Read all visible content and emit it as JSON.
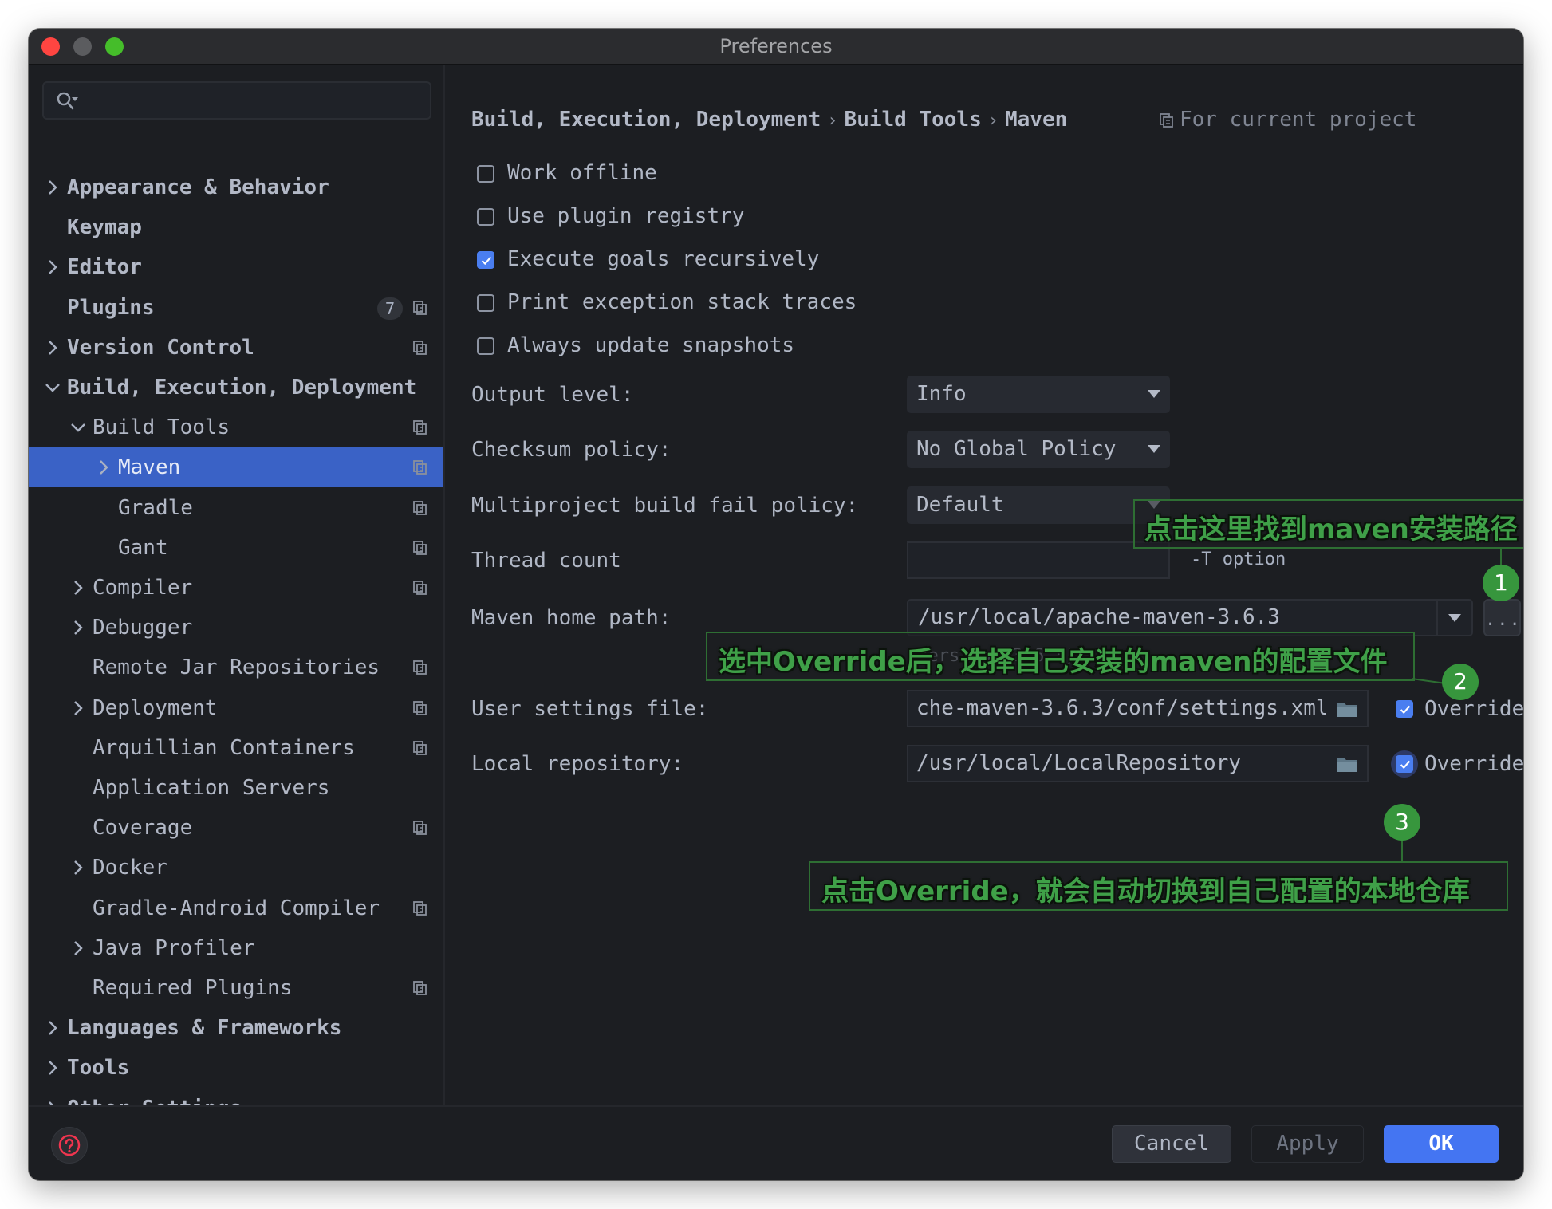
{
  "window": {
    "title": "Preferences",
    "traffic_lights": [
      "close",
      "minimize",
      "zoom"
    ]
  },
  "search": {
    "placeholder": "",
    "value": "",
    "icon": "search-icon"
  },
  "sidebar": {
    "items": [
      {
        "label": "Appearance & Behavior",
        "level": 0,
        "expander": "collapsed",
        "bold": true,
        "project_icon": false
      },
      {
        "label": "Keymap",
        "level": 0,
        "expander": "none",
        "bold": true,
        "project_icon": false
      },
      {
        "label": "Editor",
        "level": 0,
        "expander": "collapsed",
        "bold": true,
        "project_icon": false
      },
      {
        "label": "Plugins",
        "level": 0,
        "expander": "none",
        "bold": true,
        "project_icon": true,
        "badge": "7"
      },
      {
        "label": "Version Control",
        "level": 0,
        "expander": "collapsed",
        "bold": true,
        "project_icon": true
      },
      {
        "label": "Build, Execution, Deployment",
        "level": 0,
        "expander": "expanded",
        "bold": true,
        "project_icon": false
      },
      {
        "label": "Build Tools",
        "level": 1,
        "expander": "expanded",
        "bold": false,
        "project_icon": true
      },
      {
        "label": "Maven",
        "level": 2,
        "expander": "collapsed",
        "bold": false,
        "project_icon": true,
        "selected": true
      },
      {
        "label": "Gradle",
        "level": 2,
        "expander": "none",
        "bold": false,
        "project_icon": true
      },
      {
        "label": "Gant",
        "level": 2,
        "expander": "none",
        "bold": false,
        "project_icon": true
      },
      {
        "label": "Compiler",
        "level": 1,
        "expander": "collapsed",
        "bold": false,
        "project_icon": true
      },
      {
        "label": "Debugger",
        "level": 1,
        "expander": "collapsed",
        "bold": false,
        "project_icon": false
      },
      {
        "label": "Remote Jar Repositories",
        "level": 1,
        "expander": "none",
        "bold": false,
        "project_icon": true
      },
      {
        "label": "Deployment",
        "level": 1,
        "expander": "collapsed",
        "bold": false,
        "project_icon": true
      },
      {
        "label": "Arquillian Containers",
        "level": 1,
        "expander": "none",
        "bold": false,
        "project_icon": true
      },
      {
        "label": "Application Servers",
        "level": 1,
        "expander": "none",
        "bold": false,
        "project_icon": false
      },
      {
        "label": "Coverage",
        "level": 1,
        "expander": "none",
        "bold": false,
        "project_icon": true
      },
      {
        "label": "Docker",
        "level": 1,
        "expander": "collapsed",
        "bold": false,
        "project_icon": false
      },
      {
        "label": "Gradle-Android Compiler",
        "level": 1,
        "expander": "none",
        "bold": false,
        "project_icon": true
      },
      {
        "label": "Java Profiler",
        "level": 1,
        "expander": "collapsed",
        "bold": false,
        "project_icon": false
      },
      {
        "label": "Required Plugins",
        "level": 1,
        "expander": "none",
        "bold": false,
        "project_icon": true
      },
      {
        "label": "Languages & Frameworks",
        "level": 0,
        "expander": "collapsed",
        "bold": true,
        "project_icon": false
      },
      {
        "label": "Tools",
        "level": 0,
        "expander": "collapsed",
        "bold": true,
        "project_icon": false
      },
      {
        "label": "Other Settings",
        "level": 0,
        "expander": "collapsed",
        "bold": true,
        "project_icon": false
      }
    ]
  },
  "breadcrumb": {
    "items": [
      "Build, Execution, Deployment",
      "Build Tools",
      "Maven"
    ],
    "separator": "›",
    "scope_label": "For current project"
  },
  "checkboxes": [
    {
      "label": "Work offline",
      "checked": false
    },
    {
      "label": "Use plugin registry",
      "checked": false
    },
    {
      "label": "Execute goals recursively",
      "checked": true
    },
    {
      "label": "Print exception stack traces",
      "checked": false
    },
    {
      "label": "Always update snapshots",
      "checked": false
    }
  ],
  "form": {
    "output_level": {
      "label": "Output level:",
      "value": "Info"
    },
    "checksum_policy": {
      "label": "Checksum policy:",
      "value": "No Global Policy"
    },
    "multiproject_fail_policy": {
      "label": "Multiproject build fail policy:",
      "value": "Default"
    },
    "thread_count": {
      "label": "Thread count",
      "value": "",
      "hint": "-T option"
    },
    "maven_home": {
      "label": "Maven home path:",
      "value": "/usr/local/apache-maven-3.6.3",
      "browse_label": "...",
      "version_hint": "(Version: 3.6.3)"
    },
    "user_settings": {
      "label": "User settings file:",
      "value": "che-maven-3.6.3/conf/settings.xml",
      "override_label": "Override",
      "override_checked": true
    },
    "local_repository": {
      "label": "Local repository:",
      "value": "/usr/local/LocalRepository",
      "override_label": "Override",
      "override_checked": true
    }
  },
  "annotations": [
    {
      "number": "1",
      "text": "点击这里找到maven安装路径"
    },
    {
      "number": "2",
      "text": "选中Override后，选择自己安装的maven的配置文件"
    },
    {
      "number": "3",
      "text": "点击Override，就会自动切换到自己配置的本地仓库"
    }
  ],
  "footer": {
    "help_icon": "help-icon",
    "cancel_label": "Cancel",
    "apply_label": "Apply",
    "ok_label": "OK"
  },
  "colors": {
    "accent": "#4475f2",
    "selection": "#3a62c6",
    "annotation_green": "#37963d",
    "help_red": "#f0354f"
  }
}
